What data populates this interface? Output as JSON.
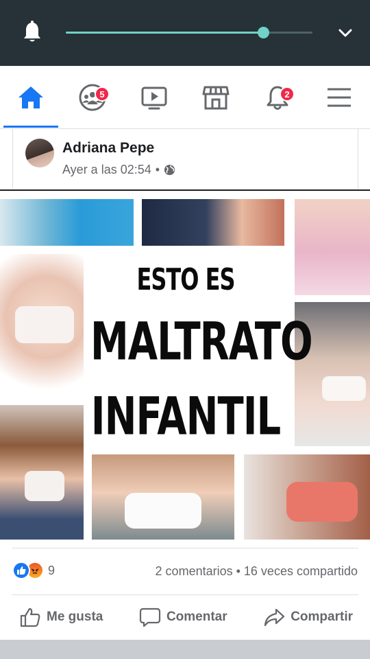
{
  "status_bar": {
    "icons": [
      "bell-icon",
      "chevron-down-icon"
    ],
    "progress": 0.8,
    "accent_color": "#6fd3c5"
  },
  "nav": {
    "items": [
      {
        "name": "home",
        "icon": "home-icon",
        "active": true
      },
      {
        "name": "groups",
        "icon": "groups-icon",
        "badge": "5"
      },
      {
        "name": "watch",
        "icon": "video-icon"
      },
      {
        "name": "marketplace",
        "icon": "store-icon"
      },
      {
        "name": "notifications",
        "icon": "bell-icon",
        "badge": "2"
      },
      {
        "name": "menu",
        "icon": "hamburger-icon"
      }
    ],
    "accent_color": "#1877f2",
    "badge_color": "#f02849"
  },
  "post": {
    "author": "Adriana Pepe",
    "timestamp": "Ayer a las 02:54",
    "separator": "•",
    "privacy_icon": "globe-icon",
    "image": {
      "line1": "ESTO ES",
      "line2": "MALTRATO",
      "line3": "INFANTIL"
    },
    "reactions": {
      "types": [
        "like",
        "angry"
      ],
      "count": "9"
    },
    "stats": "2 comentarios • 16 veces compartido",
    "actions": {
      "like": "Me gusta",
      "comment": "Comentar",
      "share": "Compartir"
    }
  }
}
